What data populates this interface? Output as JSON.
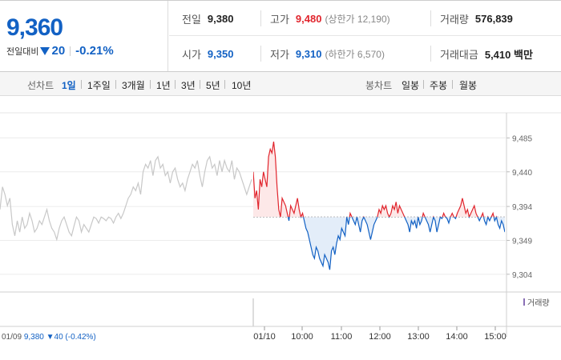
{
  "quote": {
    "price": "9,360",
    "change_label": "전일대비",
    "change_value": "20",
    "change_pct": "-0.21%",
    "fields": {
      "prev_close": {
        "label": "전일",
        "value": "9,380"
      },
      "high": {
        "label": "고가",
        "value": "9,480",
        "sub": "(상한가 12,190)"
      },
      "volume": {
        "label": "거래량",
        "value": "576,839"
      },
      "open": {
        "label": "시가",
        "value": "9,350"
      },
      "low": {
        "label": "저가",
        "value": "9,310",
        "sub": "(하한가 6,570)"
      },
      "turnover": {
        "label": "거래대금",
        "value": "5,410 백만"
      }
    }
  },
  "tabs": {
    "line_label": "선차트",
    "line_tabs": [
      "1일",
      "1주일",
      "3개월",
      "1년",
      "3년",
      "5년",
      "10년"
    ],
    "active": "1일",
    "candle_label": "봉차트",
    "candle_tabs": [
      "일봉",
      "주봉",
      "월봉"
    ]
  },
  "chart_data": {
    "type": "line",
    "ylim": [
      9290,
      9495
    ],
    "yticks": [
      "9,485",
      "9,440",
      "9,394",
      "9,349",
      "9,304"
    ],
    "ytick_values": [
      9485,
      9440,
      9394,
      9349,
      9304
    ],
    "reference_line": 9380,
    "xticks": [
      "01/10",
      "10:00",
      "11:00",
      "12:00",
      "13:00",
      "14:00",
      "15:00"
    ],
    "prev_day_info": {
      "date": "01/09",
      "close": "9,380",
      "change": "40",
      "change_pct": "(-0.42%)"
    },
    "volume_legend": "거래량",
    "colors": {
      "up": "#e1252d",
      "down": "#1261c4",
      "prev": "#c8c8c8",
      "up_fill": "#fde8e8",
      "down_fill": "#e3edf9"
    },
    "prev_day_series": [
      9390,
      9420,
      9410,
      9395,
      9405,
      9370,
      9355,
      9375,
      9360,
      9380,
      9365,
      9370,
      9385,
      9375,
      9360,
      9365,
      9375,
      9370,
      9380,
      9390,
      9375,
      9365,
      9360,
      9350,
      9365,
      9375,
      9380,
      9370,
      9360,
      9355,
      9368,
      9380,
      9375,
      9360,
      9370,
      9365,
      9360,
      9370,
      9380,
      9378,
      9372,
      9380,
      9378,
      9375,
      9380,
      9378,
      9372,
      9380,
      9385,
      9378,
      9385,
      9395,
      9405,
      9410,
      9420,
      9415,
      9425,
      9410,
      9440,
      9450,
      9445,
      9455,
      9435,
      9455,
      9460,
      9445,
      9450,
      9435,
      9440,
      9425,
      9440,
      9445,
      9430,
      9420,
      9425,
      9415,
      9430,
      9440,
      9450,
      9445,
      9455,
      9435,
      9420,
      9440,
      9455,
      9460,
      9445,
      9450,
      9435,
      9455,
      9440,
      9455,
      9445,
      9440,
      9455,
      9430,
      9445,
      9440,
      9430,
      9420,
      9410,
      9420,
      9430
    ],
    "today_series": [
      9440,
      9405,
      9415,
      9390,
      9430,
      9420,
      9440,
      9430,
      9420,
      9460,
      9470,
      9465,
      9480,
      9460,
      9420,
      9390,
      9380,
      9405,
      9400,
      9395,
      9385,
      9375,
      9395,
      9390,
      9385,
      9395,
      9405,
      9390,
      9380,
      9385,
      9375,
      9365,
      9360,
      9350,
      9340,
      9330,
      9325,
      9340,
      9335,
      9325,
      9320,
      9315,
      9330,
      9325,
      9320,
      9310,
      9335,
      9340,
      9330,
      9345,
      9355,
      9350,
      9365,
      9360,
      9355,
      9380,
      9370,
      9385,
      9380,
      9375,
      9370,
      9380,
      9370,
      9360,
      9375,
      9380,
      9375,
      9370,
      9360,
      9350,
      9360,
      9370,
      9375,
      9380,
      9390,
      9385,
      9395,
      9390,
      9395,
      9385,
      9380,
      9385,
      9395,
      9390,
      9400,
      9385,
      9395,
      9390,
      9385,
      9380,
      9375,
      9370,
      9360,
      9375,
      9370,
      9375,
      9365,
      9380,
      9370,
      9375,
      9385,
      9380,
      9375,
      9370,
      9360,
      9370,
      9380,
      9375,
      9360,
      9370,
      9380,
      9378,
      9385,
      9380,
      9378,
      9372,
      9380,
      9385,
      9380,
      9378,
      9385,
      9390,
      9395,
      9405,
      9395,
      9385,
      9390,
      9380,
      9385,
      9390,
      9395,
      9385,
      9380,
      9375,
      9380,
      9385,
      9375,
      9370,
      9380,
      9375,
      9380,
      9385,
      9375,
      9380,
      9370,
      9365,
      9375,
      9370,
      9360
    ]
  }
}
